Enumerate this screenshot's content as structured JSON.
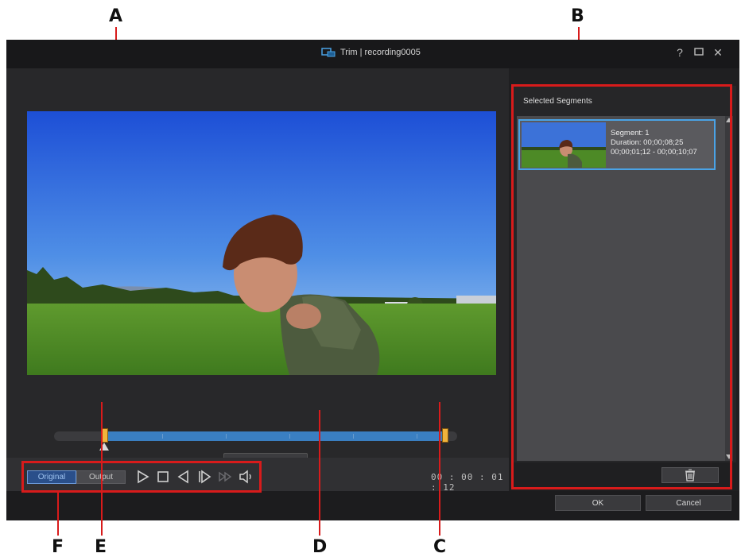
{
  "window": {
    "title": "Trim | recording0005",
    "help_label": "?",
    "close_label": "✕"
  },
  "callouts": {
    "a": "A",
    "b": "B",
    "c": "C",
    "d": "D",
    "e": "E",
    "f": "F"
  },
  "player": {
    "mode_original": "Original",
    "mode_output": "Output",
    "timecode": "00 : 00 : 01 : 12",
    "trim_range_start": 0.125,
    "trim_range_end": 0.975
  },
  "segments_panel": {
    "title": "Selected Segments",
    "segments": [
      {
        "segment": "Segment: 1",
        "duration": "Duration: 00;00;08;25",
        "range": "00;00;01;12 - 00;00;10;07"
      }
    ]
  },
  "footer": {
    "ok_label": "OK",
    "cancel_label": "Cancel"
  },
  "colors": {
    "annotation_red": "#d81b1b",
    "accent_blue": "#3a7fc2",
    "handle_yellow": "#f0b43c",
    "selection_border": "#4aa3e6"
  }
}
